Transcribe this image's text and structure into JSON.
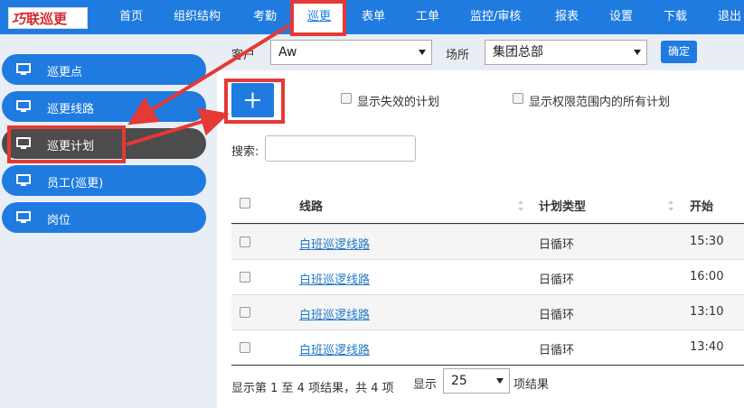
{
  "app": {
    "logo_mark": "巧",
    "logo_text": "联巡更"
  },
  "nav": [
    "首页",
    "组织结构",
    "考勤",
    "巡更",
    "表单",
    "工单",
    "监控/审核",
    "报表",
    "设置",
    "下载",
    "退出"
  ],
  "sidebar": {
    "items": [
      {
        "label": "巡更点"
      },
      {
        "label": "巡更线路"
      },
      {
        "label": "巡更计划"
      },
      {
        "label": "员工(巡更)"
      },
      {
        "label": "岗位"
      }
    ]
  },
  "filters": {
    "customer_label": "客户",
    "customer_value": "Aw",
    "site_label": "场所",
    "site_value": "集团总部",
    "confirm_label": "确定"
  },
  "content": {
    "add_label": "+",
    "show_expired_label": "显示失效的计划",
    "show_all_label": "显示权限范围内的所有计划",
    "search_label": "搜索:"
  },
  "table": {
    "columns": [
      "线路",
      "计划类型",
      "开始"
    ],
    "rows": [
      {
        "route": "白班巡逻线路",
        "type": "日循环",
        "start": "15:30"
      },
      {
        "route": "白班巡逻线路",
        "type": "日循环",
        "start": "16:00"
      },
      {
        "route": "白班巡逻线路",
        "type": "日循环",
        "start": "13:10"
      },
      {
        "route": "白班巡逻线路",
        "type": "日循环",
        "start": "13:40"
      }
    ]
  },
  "footer": {
    "summary": "显示第 1 至 4 项结果，共 4 项",
    "show_label": "显示",
    "page_size": "25",
    "suffix": "项结果"
  },
  "colors": {
    "primary": "#1f7be0",
    "annotation": "#e53935",
    "active_sidebar": "#4c4c4c"
  }
}
